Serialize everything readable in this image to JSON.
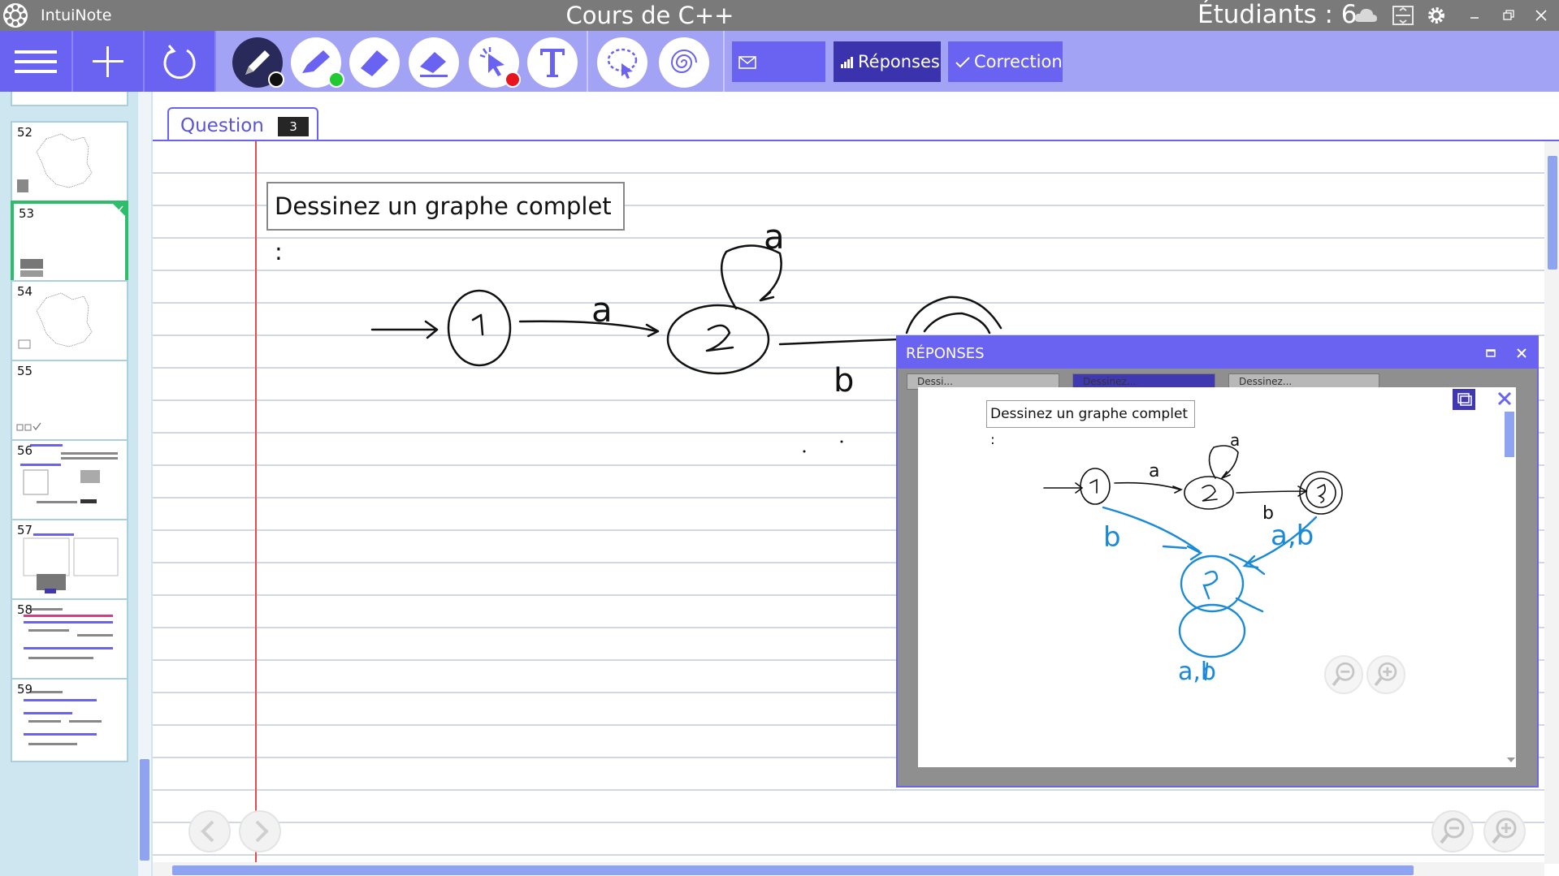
{
  "app": {
    "name": "IntuiNote",
    "document_title": "Cours de C++",
    "students_label": "Étudiants : 6"
  },
  "toolbar": {
    "send_label": "Envoyer",
    "responses_label": "Réponses",
    "correction_label": "Correction",
    "tool_colors": {
      "pen": "#111111",
      "highlighter": "#22c933",
      "pointer": "#e8141e"
    }
  },
  "sidebar": {
    "pages": [
      {
        "number": "52"
      },
      {
        "number": "53"
      },
      {
        "number": "54"
      },
      {
        "number": "55"
      },
      {
        "number": "56"
      },
      {
        "number": "57"
      },
      {
        "number": "58"
      },
      {
        "number": "59"
      }
    ]
  },
  "question": {
    "tab_label": "Question",
    "number": "3",
    "prompt": "Dessinez un graphe complet :",
    "labels": {
      "a1": "a",
      "a2": "a",
      "b1": "b"
    }
  },
  "responses": {
    "title": "RÉPONSES",
    "tabs": [
      "Dessi...",
      "Dessinez...",
      "Dessinez..."
    ],
    "card_prompt": "Dessinez un graphe complet :",
    "card_labels": {
      "a1": "a",
      "a2": "a",
      "b1": "b",
      "b2": "b",
      "ab1": "a,b",
      "ab2": "a,b"
    }
  },
  "colors": {
    "accent": "#6a62f0",
    "toolbar_bg": "#a3a3f5",
    "sidebar_bg": "#cde6ef",
    "selected_border": "#2ebd6b",
    "margin_red": "#e24c4c",
    "answer_ink": "#1a8ad8"
  }
}
